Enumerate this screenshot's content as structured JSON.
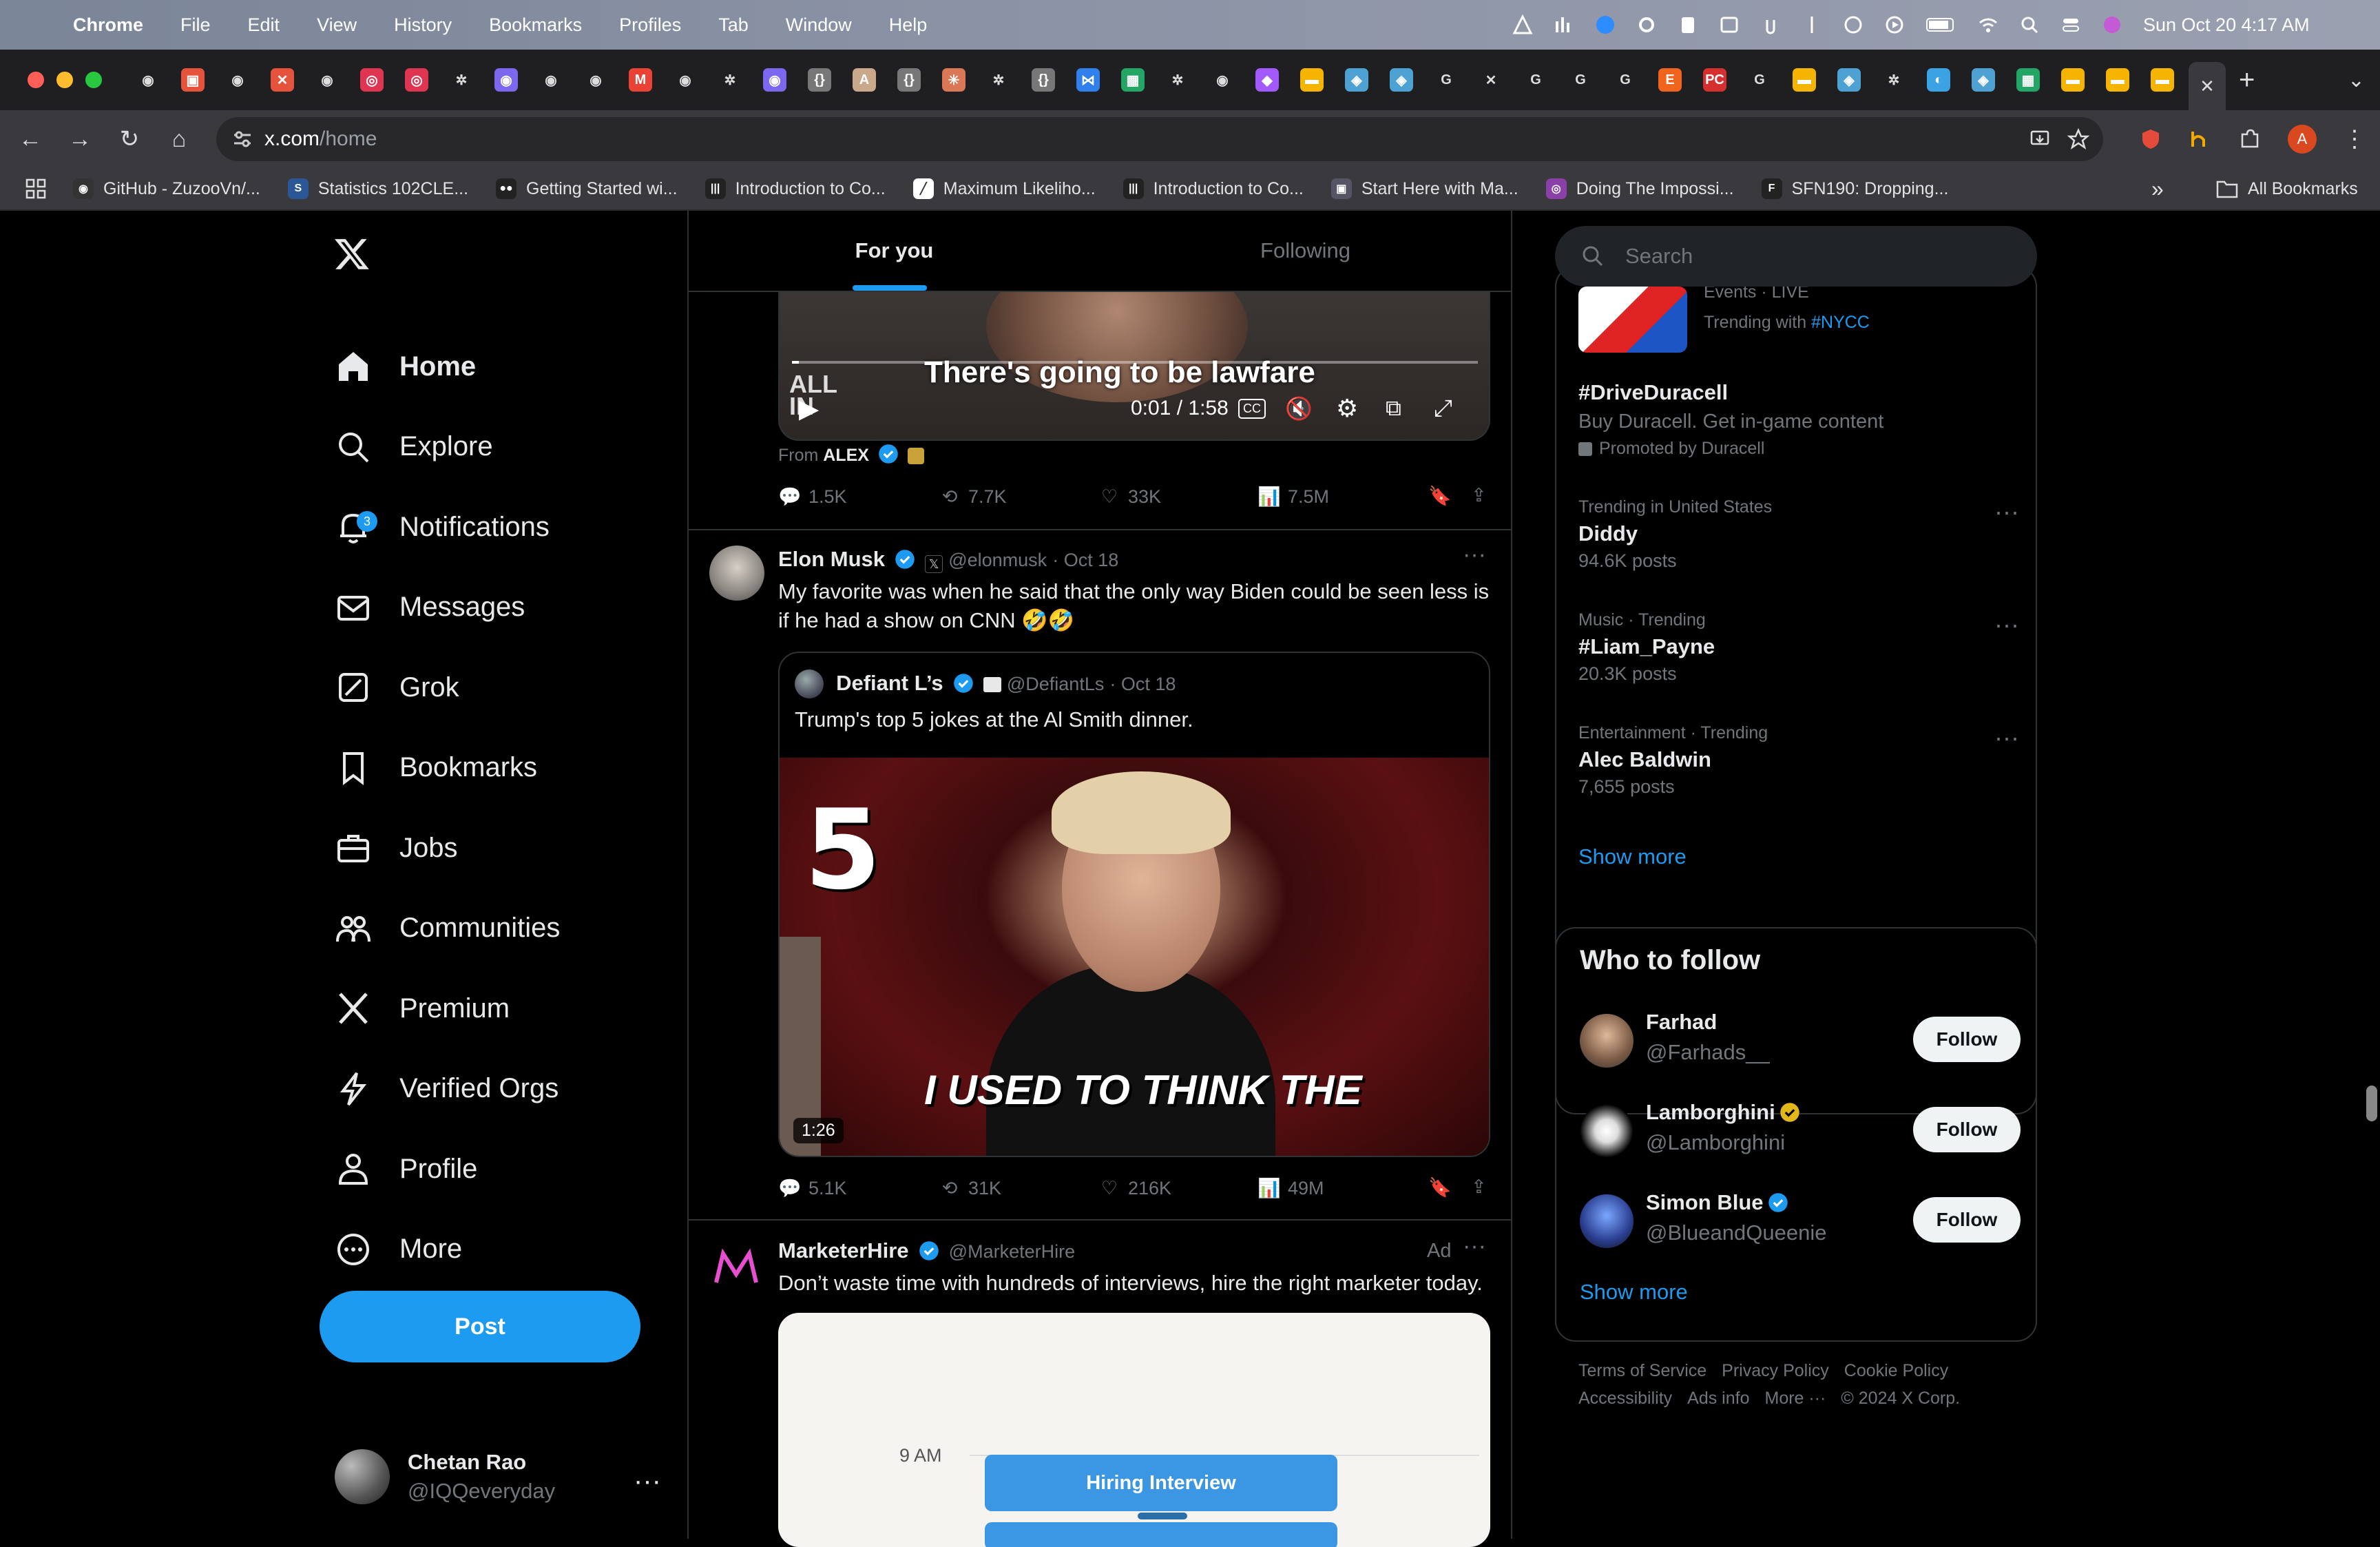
{
  "menubar": {
    "items": [
      "Chrome",
      "File",
      "Edit",
      "View",
      "History",
      "Bookmarks",
      "Profiles",
      "Tab",
      "Window",
      "Help"
    ],
    "clock": "Sun Oct 20  4:17 AM"
  },
  "browser": {
    "url_host": "x.com",
    "url_path": "/home",
    "profile_initial": "A",
    "bookmarks": [
      "GitHub - ZuzooVn/...",
      "Statistics 102CLE...",
      "Getting Started wi...",
      "Introduction to Co...",
      "Maximum Likeliho...",
      "Introduction to Co...",
      "Start Here with Ma...",
      "Doing The Impossi...",
      "SFN190: Dropping..."
    ],
    "all_bookmarks": "All Bookmarks"
  },
  "nav": {
    "items": [
      {
        "label": "Home"
      },
      {
        "label": "Explore"
      },
      {
        "label": "Notifications",
        "badge": "3"
      },
      {
        "label": "Messages"
      },
      {
        "label": "Grok"
      },
      {
        "label": "Bookmarks"
      },
      {
        "label": "Jobs"
      },
      {
        "label": "Communities"
      },
      {
        "label": "Premium"
      },
      {
        "label": "Verified Orgs"
      },
      {
        "label": "Profile"
      },
      {
        "label": "More"
      }
    ],
    "post_label": "Post",
    "account": {
      "name": "Chetan Rao",
      "handle": "@IQQeveryday"
    }
  },
  "feed": {
    "tabs": [
      "For you",
      "Following"
    ],
    "tweet1": {
      "caption": "There's going to be lawfare",
      "watermark": "ALL IN",
      "time": "0:01 / 1:58",
      "progress": 0.01,
      "from_label": "From",
      "from_name": "ALEX",
      "replies": "1.5K",
      "retweets": "7.7K",
      "likes": "33K",
      "views": "7.5M"
    },
    "tweet2": {
      "name": "Elon Musk",
      "handle": "@elonmusk",
      "date": "· Oct 18",
      "text": "My favorite was when he said that the only way Biden could be seen less is if he had a show on CNN 🤣🤣",
      "quote": {
        "name": "Defiant L’s",
        "handle": "@DefiantLs",
        "date": "· Oct 18",
        "text": "Trump's top 5 jokes at the Al Smith dinner.",
        "overlay_number": "5",
        "overlay_caption": "I USED TO THINK THE",
        "duration": "1:26"
      },
      "replies": "5.1K",
      "retweets": "31K",
      "likes": "216K",
      "views": "49M"
    },
    "tweet3": {
      "name": "MarketerHire",
      "handle": "@MarketerHire",
      "ad_label": "Ad",
      "text": "Don’t waste time with hundreds of interviews, hire the right marketer today.",
      "card_time": "9 AM",
      "card_slot": "Hiring Interview"
    }
  },
  "sidebar": {
    "search_placeholder": "Search",
    "trend_top": {
      "label": "Events · LIVE",
      "text": "Trending with",
      "hashtag": "#NYCC"
    },
    "promoted": {
      "title": "#DriveDuracell",
      "desc": "Buy Duracell. Get in-game content",
      "by": "Promoted by Duracell"
    },
    "trends": [
      {
        "label": "Trending in United States",
        "title": "Diddy",
        "posts": "94.6K posts"
      },
      {
        "label": "Music · Trending",
        "title": "#Liam_Payne",
        "posts": "20.3K posts"
      },
      {
        "label": "Entertainment · Trending",
        "title": "Alec Baldwin",
        "posts": "7,655 posts"
      }
    ],
    "show_more": "Show more",
    "who_to_follow": {
      "title": "Who to follow",
      "users": [
        {
          "name": "Farhad",
          "handle": "@Farhads__",
          "verified": ""
        },
        {
          "name": "Lamborghini",
          "handle": "@Lamborghini",
          "verified": "gold"
        },
        {
          "name": "Simon Blue",
          "handle": "@BlueandQueenie",
          "verified": "blue"
        }
      ],
      "follow_label": "Follow",
      "show_more": "Show more"
    },
    "footer": [
      "Terms of Service",
      "Privacy Policy",
      "Cookie Policy",
      "Accessibility",
      "Ads info",
      "More ···",
      "© 2024 X Corp."
    ]
  },
  "colors": {
    "accent": "#1d9bf0",
    "bg": "#000000",
    "border": "#2f3336",
    "muted": "#71767b",
    "gold": "#e2b719"
  }
}
